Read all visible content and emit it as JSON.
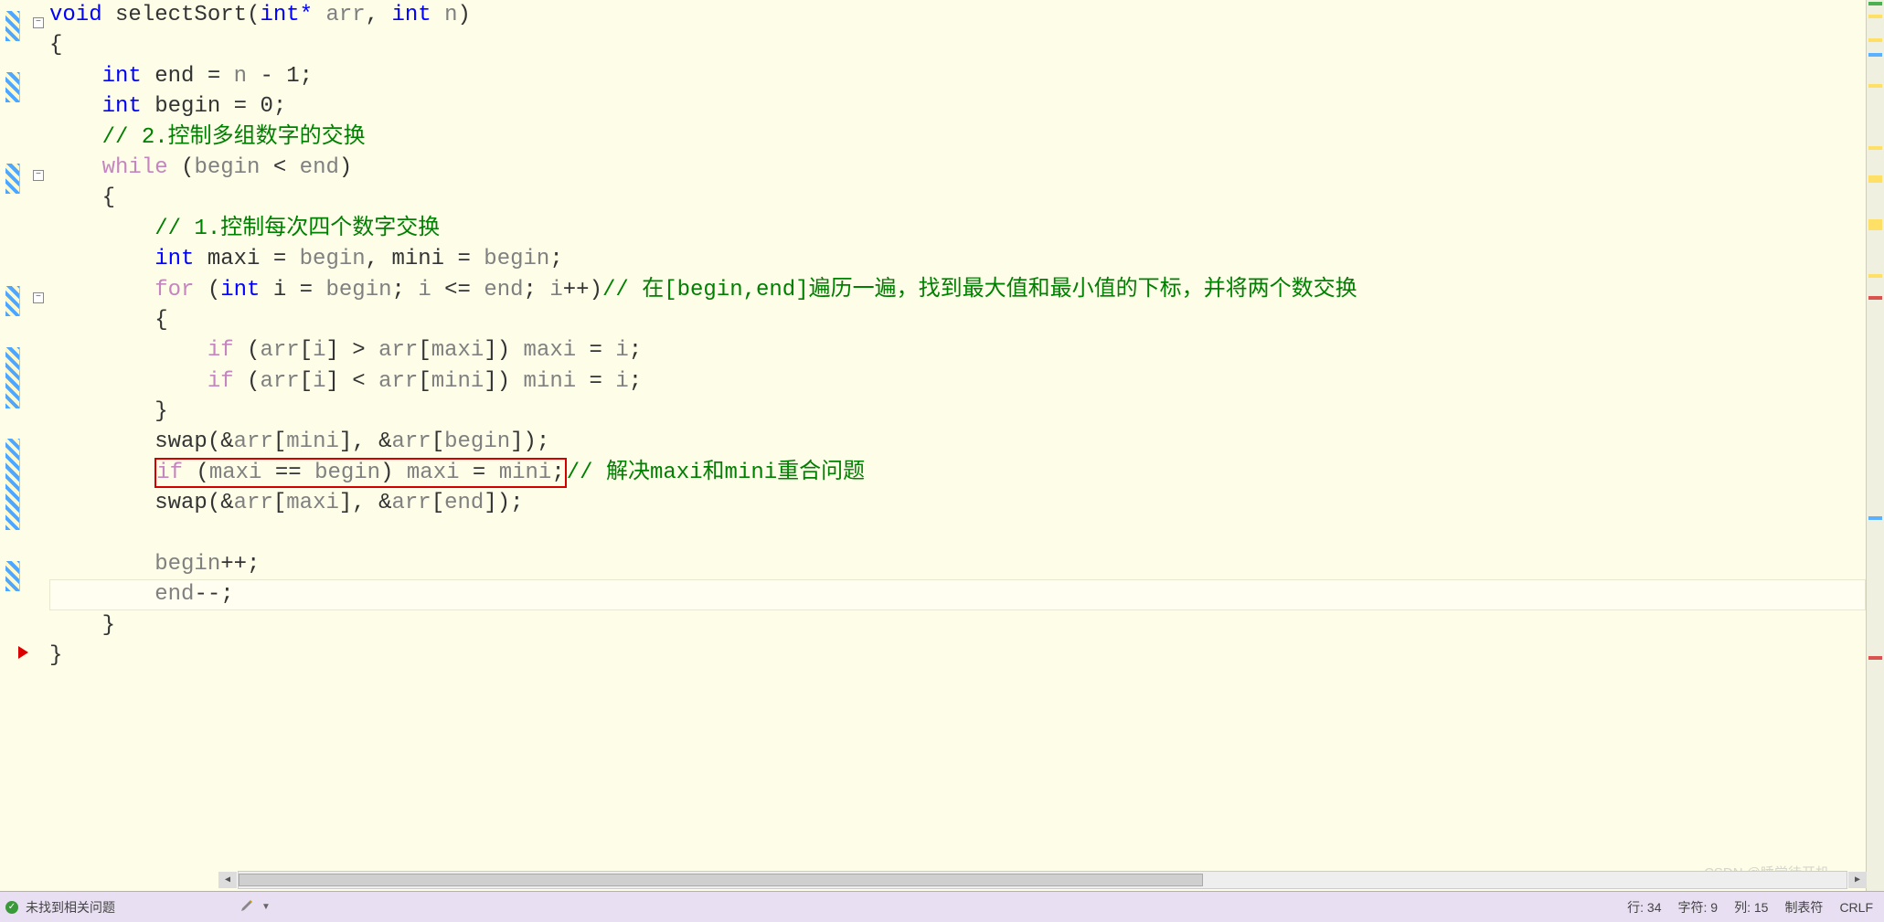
{
  "code": {
    "l1": {
      "kw_void": "void",
      "fn": "selectSort",
      "param_open": "(",
      "kw_int_ptr": "int* ",
      "p1": "arr",
      "comma": ", ",
      "kw_int2": "int",
      "p2": " n",
      "close": ")"
    },
    "l2": "{",
    "l3": {
      "indent": "    ",
      "kw": "int",
      "name": " end = ",
      "ident": "n",
      "rest": " - 1;"
    },
    "l4": {
      "indent": "    ",
      "kw": "int",
      "name": " begin = 0;"
    },
    "l5": {
      "indent": "    ",
      "comment": "// 2.控制多组数字的交换"
    },
    "l6": {
      "indent": "    ",
      "kw": "while",
      "cond_open": " (",
      "id1": "begin",
      "op": " < ",
      "id2": "end",
      "close": ")"
    },
    "l7": {
      "indent": "    ",
      "brace": "{"
    },
    "l8": {
      "indent": "        ",
      "comment": "// 1.控制每次四个数字交换"
    },
    "l9": {
      "indent": "        ",
      "kw": "int",
      "rest1": " maxi = ",
      "id1": "begin",
      "rest2": ", mini = ",
      "id2": "begin",
      "rest3": ";"
    },
    "l10": {
      "indent": "        ",
      "kw_for": "for",
      "open": " (",
      "kw_int": "int",
      "init": " i = ",
      "id_b": "begin",
      "sc": "; ",
      "id_i": "i",
      "le": " <= ",
      "id_e": "end",
      "sc2": "; ",
      "id_i2": "i",
      "pp": "++)",
      "comment": "// 在[begin,end]遍历一遍，找到最大值和最小值的下标，并将两个数交换"
    },
    "l11": {
      "indent": "        ",
      "brace": "{"
    },
    "l12": {
      "indent": "            ",
      "kw_if": "if",
      "open": " (",
      "arr1": "arr",
      "b1": "[",
      "i1": "i",
      "b2": "] > ",
      "arr2": "arr",
      "b3": "[",
      "mx": "maxi",
      "b4": "]) ",
      "mx2": "maxi",
      "eq": " = ",
      "i2": "i",
      "sc": ";"
    },
    "l13": {
      "indent": "            ",
      "kw_if": "if",
      "open": " (",
      "arr1": "arr",
      "b1": "[",
      "i1": "i",
      "b2": "] < ",
      "arr2": "arr",
      "b3": "[",
      "mn": "mini",
      "b4": "]) ",
      "mn2": "mini",
      "eq": " = ",
      "i2": "i",
      "sc": ";"
    },
    "l14": {
      "indent": "        ",
      "brace": "}"
    },
    "l15": {
      "indent": "        ",
      "fn": "swap",
      "open": "(&",
      "arr1": "arr",
      "b1": "[",
      "mn": "mini",
      "b2": "], &",
      "arr2": "arr",
      "b3": "[",
      "bg": "begin",
      "b4": "]);"
    },
    "l16": {
      "indent": "        ",
      "boxed": {
        "kw_if": "if",
        "open": " (",
        "mx": "maxi",
        "eq": " == ",
        "bg": "begin",
        "cl": ") ",
        "mx2": "maxi",
        "eq2": " = ",
        "mn": "mini",
        "sc": ";"
      },
      "comment": "// 解决maxi和mini重合问题"
    },
    "l17": {
      "indent": "        ",
      "fn": "swap",
      "open": "(&",
      "arr1": "arr",
      "b1": "[",
      "mx": "maxi",
      "b2": "], &",
      "arr2": "arr",
      "b3": "[",
      "en": "end",
      "b4": "]);"
    },
    "l18": "",
    "l19": {
      "indent": "        ",
      "id": "begin",
      "op": "++;"
    },
    "l20": {
      "indent": "        ",
      "id": "end",
      "op": "--;"
    },
    "l21": {
      "indent": "    ",
      "brace": "}"
    },
    "l22": "}"
  },
  "statusbar": {
    "no_issues": "未找到相关问题",
    "row_label": "行: ",
    "row": "34",
    "char_label": "字符: ",
    "char": "9",
    "col_label": "列: ",
    "col": "15",
    "tab_label": "制表符",
    "eol": "CRLF"
  },
  "watermark": "CSDN @睡觉待开机"
}
